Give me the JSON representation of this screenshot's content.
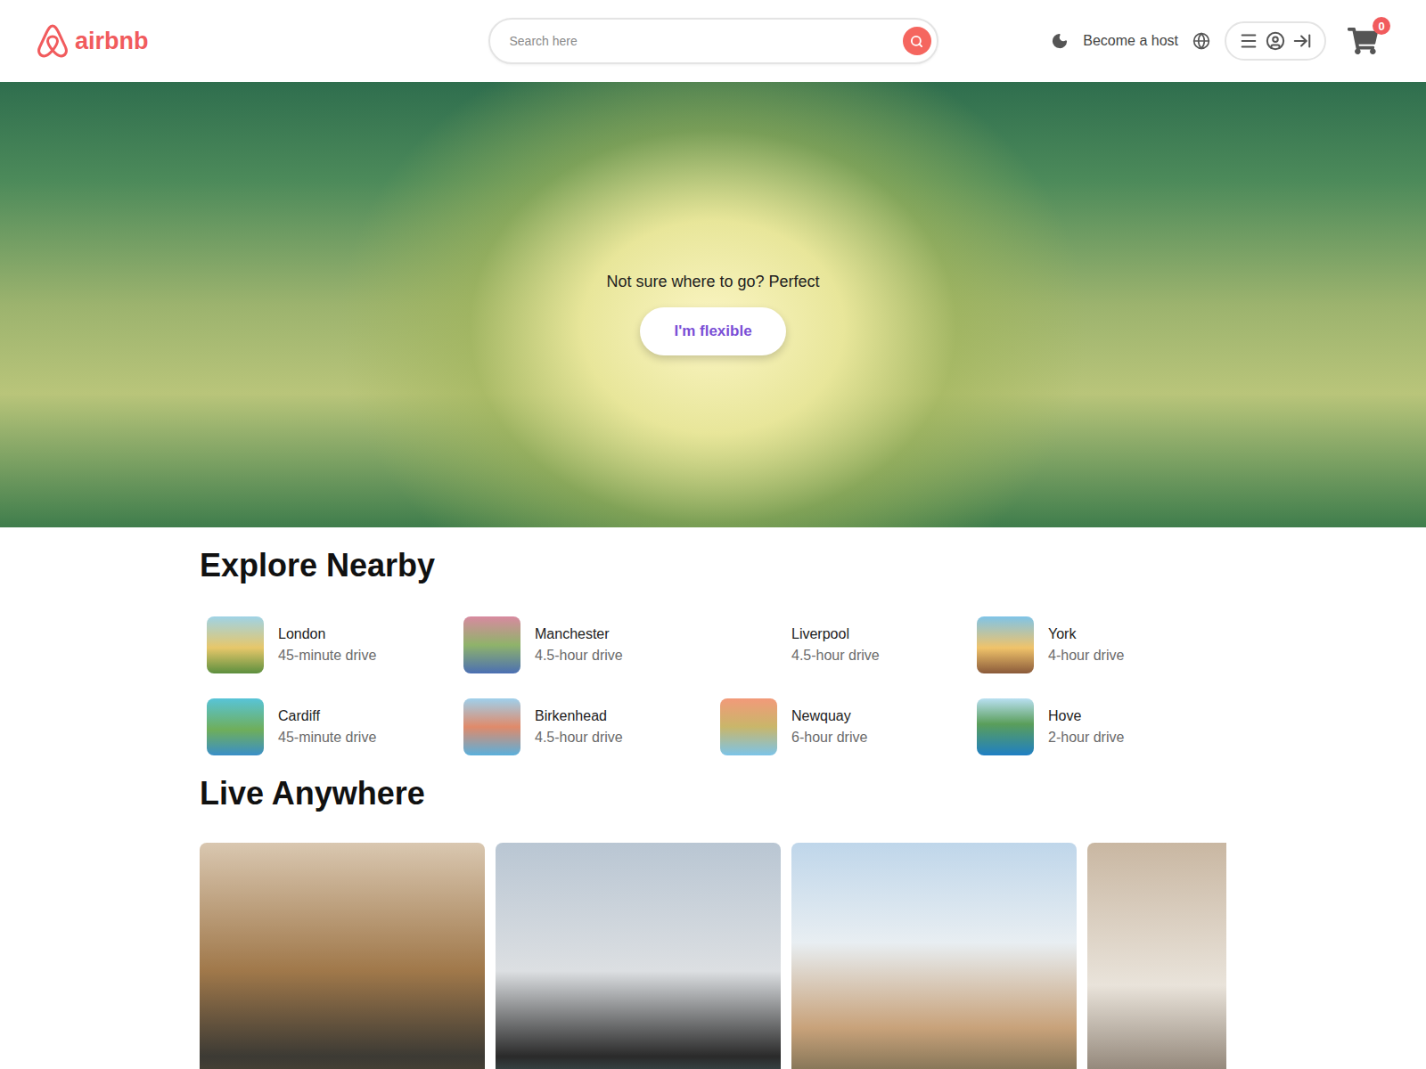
{
  "logo": "airbnb",
  "search": {
    "placeholder": "Search here"
  },
  "nav": {
    "host": "Become a host",
    "cart_count": "0"
  },
  "hero": {
    "text": "Not sure where to go? Perfect",
    "button": "I'm flexible"
  },
  "explore": {
    "title": "Explore Nearby",
    "items": [
      {
        "name": "London",
        "drive": "45-minute drive",
        "has_image": true
      },
      {
        "name": "Manchester",
        "drive": "4.5-hour drive",
        "has_image": true
      },
      {
        "name": "Liverpool",
        "drive": "4.5-hour drive",
        "has_image": false
      },
      {
        "name": "York",
        "drive": "4-hour drive",
        "has_image": true
      },
      {
        "name": "Cardiff",
        "drive": "45-minute drive",
        "has_image": true
      },
      {
        "name": "Birkenhead",
        "drive": "4.5-hour drive",
        "has_image": true
      },
      {
        "name": "Newquay",
        "drive": "6-hour drive",
        "has_image": true
      },
      {
        "name": "Hove",
        "drive": "2-hour drive",
        "has_image": true
      }
    ]
  },
  "live": {
    "title": "Live Anywhere",
    "cards": [
      {
        "kind": "photo"
      },
      {
        "kind": "photo"
      },
      {
        "kind": "photo"
      },
      {
        "kind": "photo"
      }
    ]
  }
}
